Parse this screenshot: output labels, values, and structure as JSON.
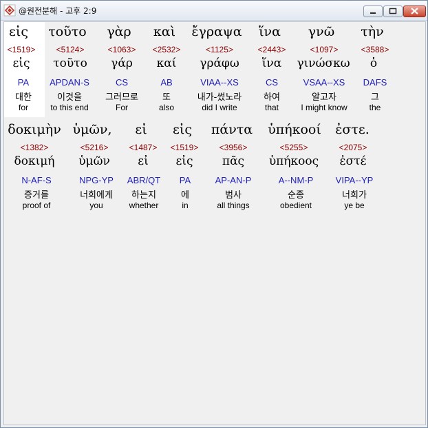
{
  "window": {
    "title": "@원전분해 - 고후 2:9",
    "buttons": {
      "minimize_icon": "minimize-icon",
      "maximize_icon": "maximize-icon",
      "close_icon": "close-icon"
    }
  },
  "rows": [
    {
      "words": [
        {
          "greek": "εἰς",
          "strong": "<1519>",
          "lemma": "εἰς",
          "parse": "PA",
          "korean": "대한",
          "english": "for"
        },
        {
          "greek": "τοῦτο",
          "strong": "<5124>",
          "lemma": "τοῦτο",
          "parse": "APDAN-S",
          "korean": "이것을",
          "english": "to this end"
        },
        {
          "greek": "γὰρ",
          "strong": "<1063>",
          "lemma": "γάρ",
          "parse": "CS",
          "korean": "그러므로",
          "english": "For"
        },
        {
          "greek": "καὶ",
          "strong": "<2532>",
          "lemma": "καί",
          "parse": "AB",
          "korean": "또",
          "english": "also"
        },
        {
          "greek": "ἔγραψα",
          "strong": "<1125>",
          "lemma": "γράφω",
          "parse": "VIAA--XS",
          "korean": "내가-썼노라",
          "english": "did I write"
        },
        {
          "greek": "ἵνα",
          "strong": "<2443>",
          "lemma": "ἵνα",
          "parse": "CS",
          "korean": "하여",
          "english": "that"
        },
        {
          "greek": "γνῶ",
          "strong": "<1097>",
          "lemma": "γινώσκω",
          "parse": "VSAA--XS",
          "korean": "알고자",
          "english": "I might know"
        },
        {
          "greek": "τὴν",
          "strong": "<3588>",
          "lemma": "ὁ",
          "parse": "DAFS",
          "korean": "그",
          "english": "the"
        }
      ]
    },
    {
      "words": [
        {
          "greek": "δοκιμὴν",
          "strong": "<1382>",
          "lemma": "δοκιμή",
          "parse": "N-AF-S",
          "korean": "증거를",
          "english": "proof of"
        },
        {
          "greek": "ὑμῶν,",
          "strong": "<5216>",
          "lemma": "ὑμῶν",
          "parse": "NPG-YP",
          "korean": "너희에게",
          "english": "you"
        },
        {
          "greek": "εἰ",
          "strong": "<1487>",
          "lemma": "εἰ",
          "parse": "ABR/QT",
          "korean": "하는지",
          "english": "whether"
        },
        {
          "greek": "εἰς",
          "strong": "<1519>",
          "lemma": "εἰς",
          "parse": "PA",
          "korean": "에",
          "english": "in"
        },
        {
          "greek": "πάντα",
          "strong": "<3956>",
          "lemma": "πᾶς",
          "parse": "AP-AN-P",
          "korean": "범사",
          "english": "all things"
        },
        {
          "greek": "ὑπήκοοί",
          "strong": "<5255>",
          "lemma": "ὑπήκοος",
          "parse": "A--NM-P",
          "korean": "순종",
          "english": "obedient"
        },
        {
          "greek": "ἐστε.",
          "strong": "<2075>",
          "lemma": "ἐστέ",
          "parse": "VIPA--YP",
          "korean": "너희가",
          "english": "ye be"
        }
      ]
    }
  ]
}
